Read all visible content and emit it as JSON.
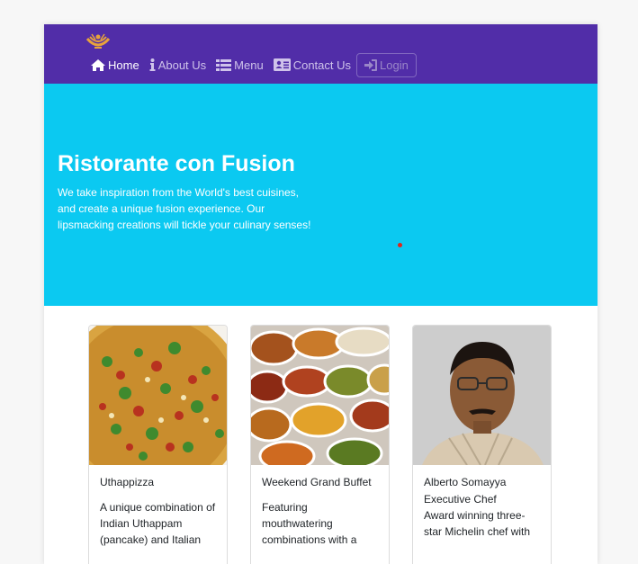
{
  "navbar": {
    "brand_color": "#512da8",
    "items": [
      {
        "label": "Home",
        "icon": "home-icon",
        "active": true
      },
      {
        "label": "About Us",
        "icon": "info-icon",
        "active": false
      },
      {
        "label": "Menu",
        "icon": "list-icon",
        "active": false
      },
      {
        "label": "Contact Us",
        "icon": "address-card-icon",
        "active": false
      }
    ],
    "login": {
      "label": "Login",
      "icon": "sign-in-icon"
    }
  },
  "jumbotron": {
    "title": "Ristorante con Fusion",
    "text": "We take inspiration from the World's best cuisines, and create a unique fusion experience. Our lipsmacking creations will tickle your culinary senses!",
    "background": "#0bc9f1"
  },
  "cards": [
    {
      "title": "Uthappizza",
      "text": "A unique combination of Indian Uthappam (pancake) and Italian"
    },
    {
      "title": "Weekend Grand Buffet",
      "text": "Featuring mouthwatering combinations with a"
    },
    {
      "title": "Alberto Somayya",
      "subtitle": "Executive Chef",
      "text": "Award winning three-star Michelin chef with"
    }
  ]
}
